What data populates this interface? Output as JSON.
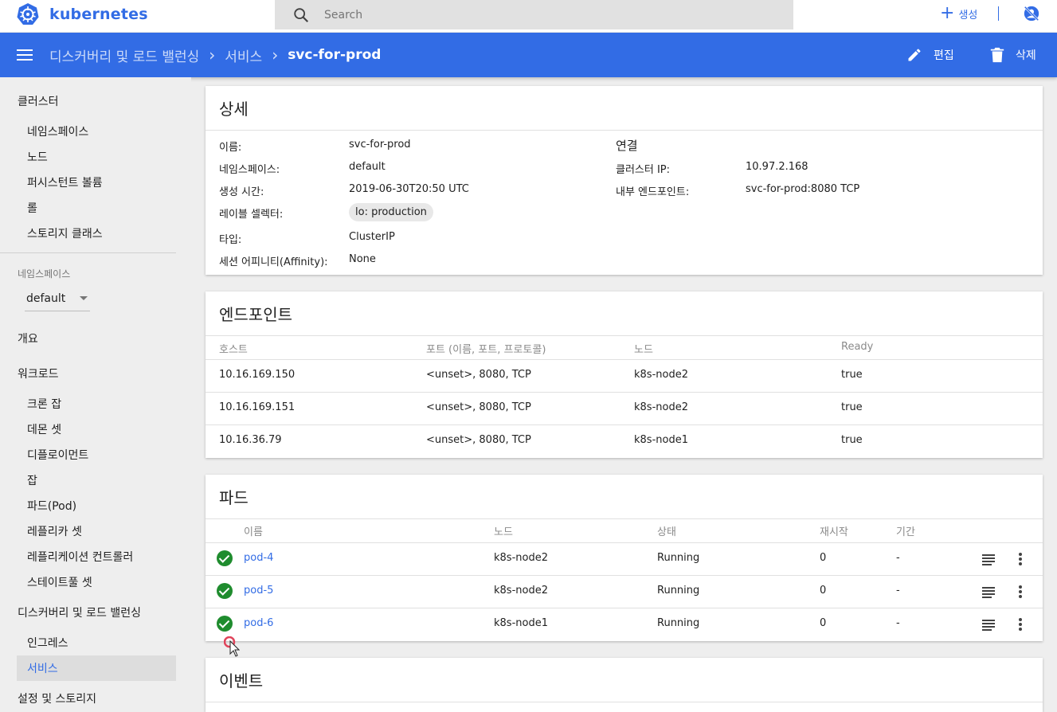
{
  "app": {
    "name": "kubernetes"
  },
  "search": {
    "placeholder": "Search"
  },
  "header": {
    "create_label": "생성"
  },
  "breadcrumb": {
    "items": [
      "디스커버리 및 로드 밸런싱",
      "서비스"
    ],
    "current": "svc-for-prod"
  },
  "toolbar": {
    "edit_label": "편집",
    "delete_label": "삭제"
  },
  "sidebar": {
    "cluster": "클러스터",
    "cluster_items": [
      "네임스페이스",
      "노드",
      "퍼시스턴트 볼륨",
      "롤",
      "스토리지 클래스"
    ],
    "namespace_label": "네임스페이스",
    "namespace_value": "default",
    "overview": "개요",
    "workloads": "워크로드",
    "workload_items": [
      "크론 잡",
      "데몬 셋",
      "디플로이먼트",
      "잡",
      "파드(Pod)",
      "레플리카 셋",
      "레플리케이션 컨트롤러",
      "스테이트풀 셋"
    ],
    "discovery": "디스커버리 및 로드 밸런싱",
    "discovery_items": [
      "인그레스",
      "서비스"
    ],
    "config": "설정 및 스토리지"
  },
  "details": {
    "title": "상세",
    "left": [
      {
        "label": "이름:",
        "value": "svc-for-prod"
      },
      {
        "label": "네임스페이스:",
        "value": "default"
      },
      {
        "label": "생성 시간:",
        "value": "2019-06-30T20:50 UTC"
      },
      {
        "label": "레이블 셀렉터:",
        "value": "lo: production"
      },
      {
        "label": "타입:",
        "value": "ClusterIP"
      },
      {
        "label": "세션 어피니티(Affinity):",
        "value": "None"
      }
    ],
    "connection_title": "연결",
    "right": [
      {
        "label": "클러스터 IP:",
        "value": "10.97.2.168"
      },
      {
        "label": "내부 엔드포인트:",
        "value": "svc-for-prod:8080 TCP"
      }
    ]
  },
  "endpoints": {
    "title": "엔드포인트",
    "columns": [
      "호스트",
      "포트 (이름, 포트, 프로토콜)",
      "노드",
      "Ready"
    ],
    "rows": [
      [
        "10.16.169.150",
        "<unset>, 8080, TCP",
        "k8s-node2",
        "true"
      ],
      [
        "10.16.169.151",
        "<unset>, 8080, TCP",
        "k8s-node2",
        "true"
      ],
      [
        "10.16.36.79",
        "<unset>, 8080, TCP",
        "k8s-node1",
        "true"
      ]
    ]
  },
  "pods": {
    "title": "파드",
    "columns": [
      "이름",
      "노드",
      "상태",
      "재시작",
      "기간"
    ],
    "rows": [
      [
        "pod-4",
        "k8s-node2",
        "Running",
        "0",
        "-"
      ],
      [
        "pod-5",
        "k8s-node2",
        "Running",
        "0",
        "-"
      ],
      [
        "pod-6",
        "k8s-node1",
        "Running",
        "0",
        "-"
      ]
    ]
  },
  "events": {
    "title": "이벤트"
  },
  "colors": {
    "primary": "#326ce5",
    "running": "#1f8c2e"
  }
}
